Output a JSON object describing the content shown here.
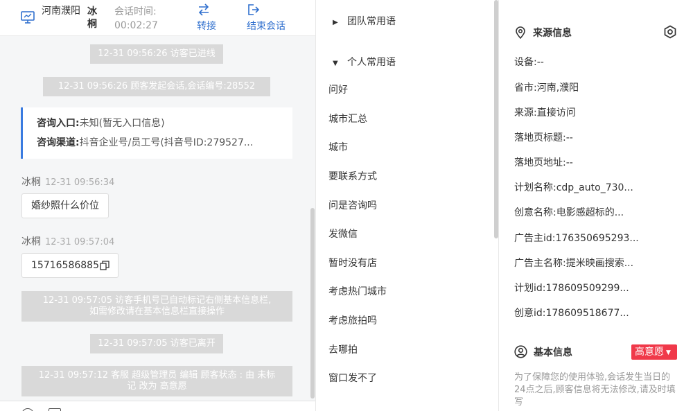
{
  "header": {
    "location": "河南濮阳",
    "agent": "冰桐",
    "session_time_label": "会话时间:",
    "session_time_value": "00:02:27",
    "transfer_label": "转接",
    "end_label": "结束会话"
  },
  "chat": {
    "sys_visitor_in": "12-31 09:56:26 访客已进线",
    "sys_session_start": "12-31 09:56:26 顾客发起会话,会话编号:28552",
    "entry_key": "咨询入口:",
    "entry_value": "未知(暂无入口信息)",
    "channel_key": "咨询渠道:",
    "channel_value": "抖音企业号/员工号(抖音号ID:279527...",
    "msg1_sender": "冰桐",
    "msg1_time": "12-31 09:56:34",
    "msg1_text": "婚纱照什么价位",
    "msg2_sender": "冰桐",
    "msg2_time": "12-31 09:57:04",
    "msg2_text": "15716586885",
    "sys_phone_line1": "12-31 09:57:05 访客手机号已自动标记右侧基本信息栏,",
    "sys_phone_line2": "如需修改请在基本信息栏直接操作",
    "sys_visitor_left": "12-31 09:57:05 访客已离开",
    "sys_status_line1": "12-31 09:57:12 客服 超级管理员 编辑 顾客状态 : 由 未标",
    "sys_status_line2": "记 改为 高意愿"
  },
  "phrases": {
    "team_group": "团队常用语",
    "personal_group": "个人常用语",
    "items": [
      "问好",
      "城市汇总",
      "城市",
      "要联系方式",
      "问是咨询吗",
      "发微信",
      "暂时没有店",
      "考虑热门城市",
      "考虑旅拍吗",
      "去哪拍",
      "窗口发不了"
    ]
  },
  "source_info": {
    "title": "来源信息",
    "device": "设备:--",
    "province": "省市:河南,濮阳",
    "source": "来源:直接访问",
    "landing_title": "落地页标题:--",
    "landing_url": "落地页地址:--",
    "plan_name": "计划名称:cdp_auto_730...",
    "creative_name": "创意名称:电影感超标的...",
    "advertiser_id": "广告主id:176350695293...",
    "advertiser_name": "广告主名称:提米映画搜索...",
    "plan_id": "计划id:178609509299...",
    "creative_id": "创意id:178609518677..."
  },
  "basic_info": {
    "title": "基本信息",
    "status_badge": "高意愿",
    "notice": "为了保障您的使用体验,会话发生当日的24点之后,顾客信息将无法修改,请及时填写"
  },
  "colors": {
    "accent_blue": "#2f6fce",
    "badge_red": "#f0394a",
    "system_msg_gray": "#d9d9d9"
  },
  "icons": {
    "header": "monitor-icon",
    "transfer": "swap-arrows-icon",
    "end": "exit-icon",
    "copy": "copy-icon",
    "source": "location-pin-icon",
    "settings": "hexagon-gear-icon",
    "basic": "user-circle-icon"
  }
}
